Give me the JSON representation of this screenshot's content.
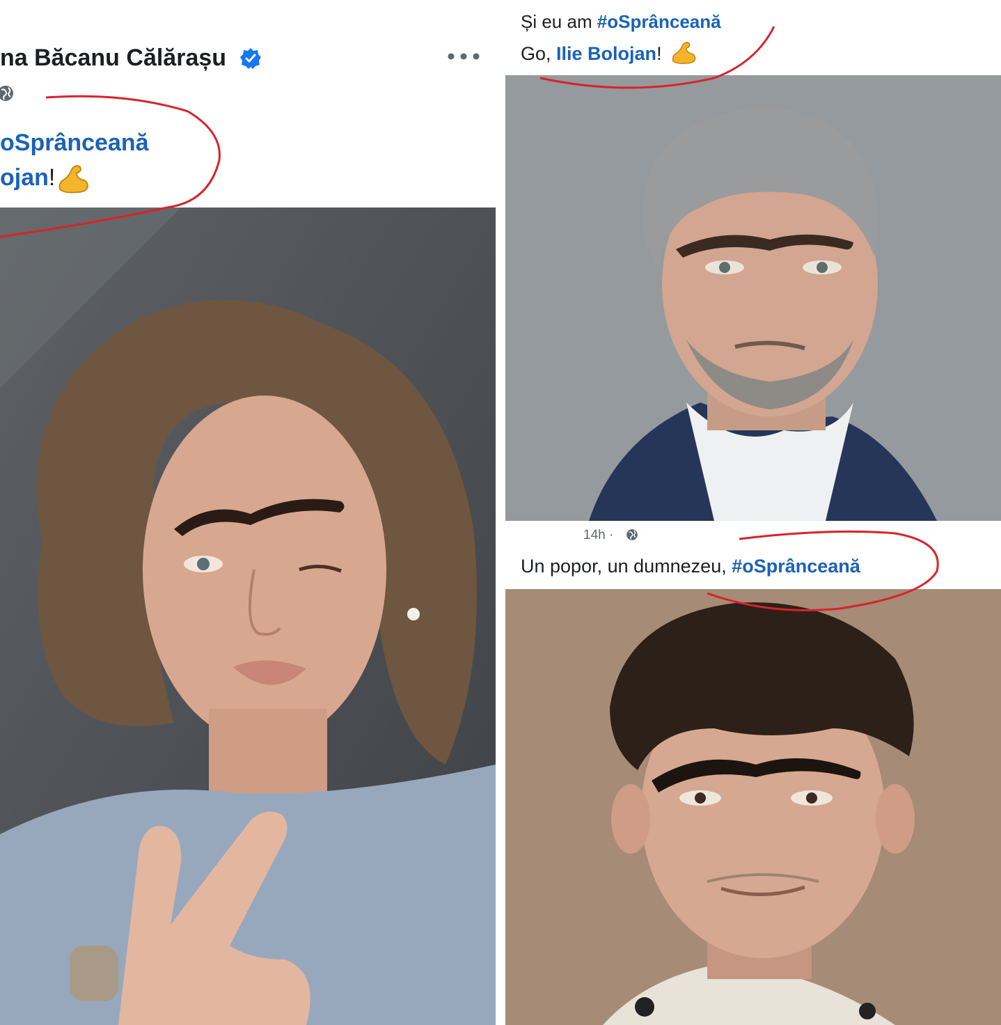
{
  "panel_left": {
    "author_name": "na Băcanu Călărașu",
    "hashtag": "oSprânceană",
    "mention": "ojan",
    "punctuation": "!",
    "more_icon": "more-options-icon",
    "verified_icon": "verified-badge-icon",
    "privacy_icon": "globe-icon"
  },
  "panel_top_right": {
    "cut_line_prefix": "Și eu am ",
    "cut_line_hashtag": "#oSprânceană",
    "go_prefix": "Go, ",
    "mention": "Ilie Bolojan",
    "punctuation": "!"
  },
  "panel_bottom_right": {
    "timestamp": "14h",
    "separator": "·",
    "caption_prefix": "Un popor, un dumnezeu, ",
    "hashtag": "#oSprânceană"
  },
  "colors": {
    "link_blue": "#1a62b8",
    "annotation_red": "#d8232a",
    "verified_blue": "#1877f2"
  }
}
